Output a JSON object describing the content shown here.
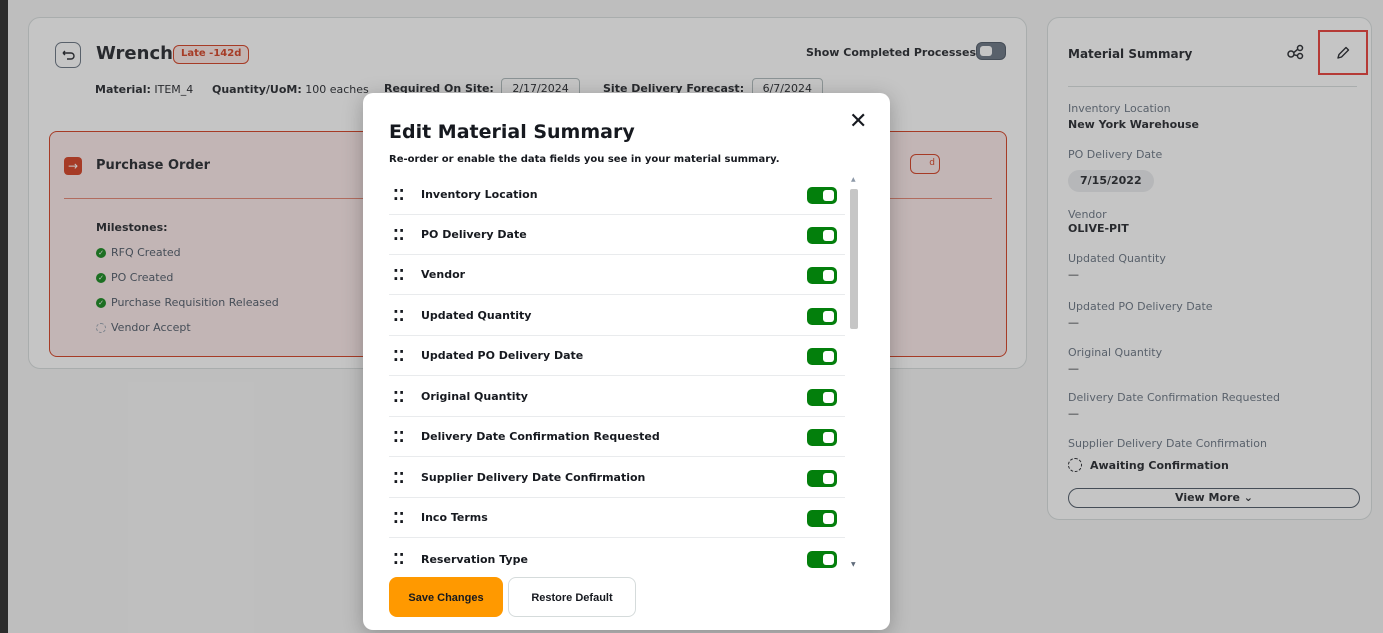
{
  "material": {
    "name": "Wrench",
    "late_badge": "Late -142d",
    "material_label": "Material:",
    "material_value": "ITEM_4",
    "quantity_label": "Quantity/UoM:",
    "quantity_value": "100 eaches",
    "required_label": "Required On Site:",
    "required_value": "2/17/2024",
    "forecast_label": "Site Delivery Forecast:",
    "forecast_value": "6/7/2024",
    "show_completed_label": "Show Completed Processes"
  },
  "purchase_order": {
    "title": "Purchase Order",
    "badge_fragment": "d",
    "milestones_label": "Milestones:",
    "milestones": [
      {
        "label": "RFQ Created",
        "status": "complete"
      },
      {
        "label": "PO Created",
        "status": "complete"
      },
      {
        "label": "Purchase Requisition Released",
        "status": "complete"
      },
      {
        "label": "Vendor Accept",
        "status": "pending"
      }
    ]
  },
  "summary": {
    "title": "Material Summary",
    "inventory_location_label": "Inventory Location",
    "inventory_location_value": "New York Warehouse",
    "po_delivery_date_label": "PO Delivery Date",
    "po_delivery_date_value": "7/15/2022",
    "vendor_label": "Vendor",
    "vendor_value": "OLIVE-PIT",
    "updated_quantity_label": "Updated Quantity",
    "updated_quantity_value": "—",
    "updated_po_date_label": "Updated PO Delivery Date",
    "updated_po_date_value": "—",
    "original_quantity_label": "Original Quantity",
    "original_quantity_value": "—",
    "confirmation_requested_label": "Delivery Date Confirmation Requested",
    "confirmation_requested_value": "—",
    "supplier_confirmation_label": "Supplier Delivery Date Confirmation",
    "supplier_confirmation_value": "Awaiting Confirmation",
    "view_more_label": "View More ⌄"
  },
  "modal": {
    "title": "Edit Material Summary",
    "subtitle": "Re-order or enable the data fields you see in your material summary.",
    "close_glyph": "✕",
    "fields": [
      {
        "label": "Inventory Location",
        "enabled": true
      },
      {
        "label": "PO Delivery Date",
        "enabled": true
      },
      {
        "label": "Vendor",
        "enabled": true
      },
      {
        "label": "Updated Quantity",
        "enabled": true
      },
      {
        "label": "Updated PO Delivery Date",
        "enabled": true
      },
      {
        "label": "Original Quantity",
        "enabled": true
      },
      {
        "label": "Delivery Date Confirmation Requested",
        "enabled": true
      },
      {
        "label": "Supplier Delivery Date Confirmation",
        "enabled": true
      },
      {
        "label": "Inco Terms",
        "enabled": true
      },
      {
        "label": "Reservation Type",
        "enabled": true
      }
    ],
    "save_label": "Save Changes",
    "restore_label": "Restore Default"
  },
  "colors": {
    "accent": "#ff9900",
    "toggle_on": "#037f0c",
    "late": "#d13212",
    "highlight": "#e8302a"
  }
}
